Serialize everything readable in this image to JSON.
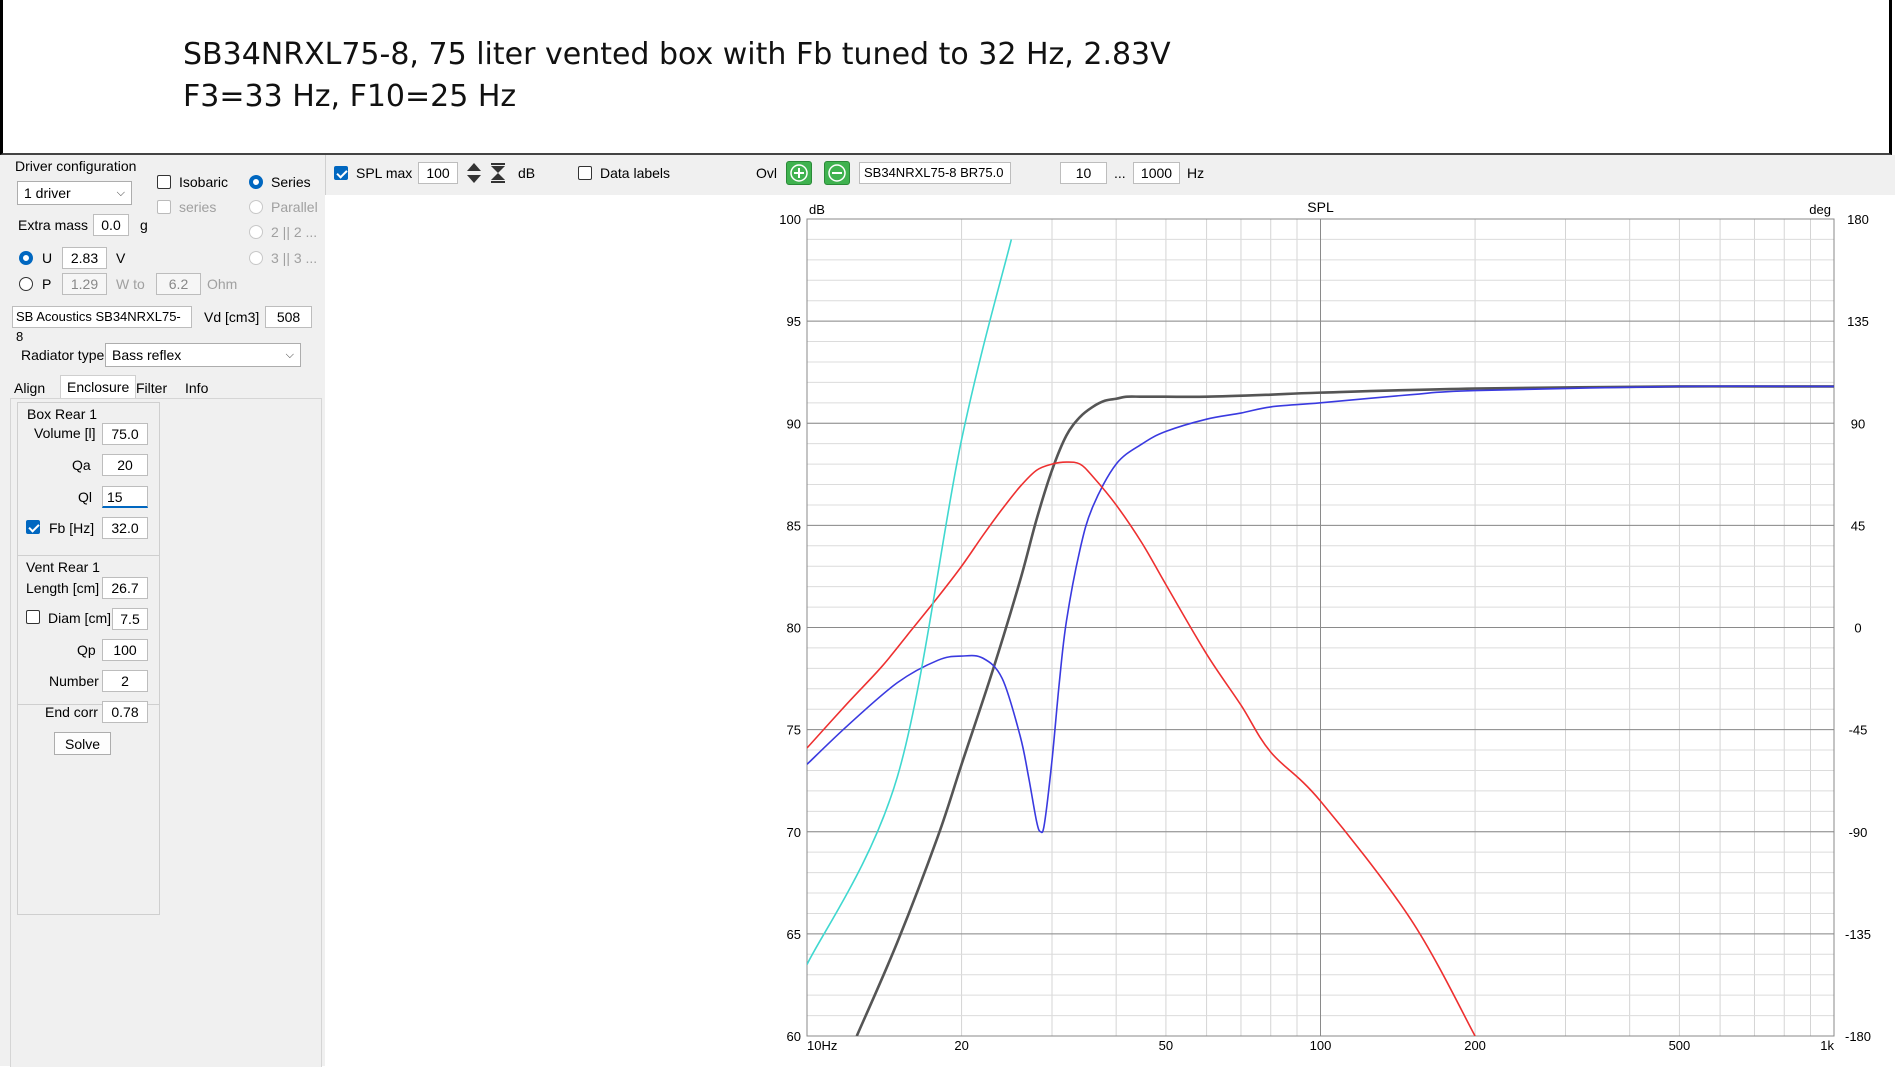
{
  "slide": {
    "title_line1": "SB34NRXL75-8, 75 liter vented box with Fb tuned to 32 Hz, 2.83V",
    "title_line2": "F3=33 Hz, F10=25 Hz"
  },
  "driver_config": {
    "group_label": "Driver configuration",
    "count_select": "1 driver",
    "isobaric_label": "Isobaric",
    "series_sub_label": "series",
    "series_label": "Series",
    "parallel_label": "Parallel",
    "opt_2x2": "2 || 2 ...",
    "opt_3x3": "3 || 3 ...",
    "extra_mass_label": "Extra mass",
    "extra_mass_value": "0.0",
    "extra_mass_unit": "g",
    "u_label": "U",
    "u_value": "2.83",
    "u_unit": "V",
    "p_label": "P",
    "p_value": "1.29",
    "w_to_label": "W to",
    "ohm_value": "6.2",
    "ohm_unit": "Ohm",
    "driver_name": "SB Acoustics SB34NRXL75-8",
    "vd_label": "Vd [cm3]",
    "vd_value": "508"
  },
  "radiator": {
    "label": "Radiator type",
    "value": "Bass reflex"
  },
  "tabs": [
    "Align",
    "Enclosure",
    "Filter",
    "Info"
  ],
  "box": {
    "group_label": "Box Rear 1",
    "volume_label": "Volume [l]",
    "volume_value": "75.0",
    "qa_label": "Qa",
    "qa_value": "20",
    "ql_label": "Ql",
    "ql_value": "15",
    "fb_label": "Fb [Hz]",
    "fb_value": "32.0"
  },
  "vent": {
    "group_label": "Vent Rear 1",
    "length_label": "Length [cm]",
    "length_value": "26.7",
    "diam_label": "Diam [cm]",
    "diam_value": "7.5",
    "qp_label": "Qp",
    "qp_value": "100",
    "number_label": "Number",
    "number_value": "2",
    "endcorr_label": "End corr",
    "endcorr_value": "0.78",
    "solve_label": "Solve"
  },
  "toolbar": {
    "spl_max_label": "SPL max",
    "spl_max_value": "100",
    "db_unit": "dB",
    "data_labels_label": "Data labels",
    "ovl_label": "Ovl",
    "overlay_name": "SB34NRXL75-8 BR75.0",
    "f_min": "10",
    "ellipsis": "...",
    "f_max": "1000",
    "hz_unit": "Hz"
  },
  "colors": {
    "accent": "#0067c0",
    "spl_black": "#555555",
    "phase_blue": "#3a3ae0",
    "red": "#ee3030",
    "cyan": "#40d8d0"
  },
  "chart_data": {
    "type": "line",
    "title": "SPL",
    "ylabel": "dB",
    "y2label": "deg",
    "x_scale": "log",
    "xlim": [
      10,
      1000
    ],
    "ylim": [
      60,
      100
    ],
    "y2lim": [
      -180,
      180
    ],
    "x_ticks": [
      {
        "v": 10,
        "label": "10Hz"
      },
      {
        "v": 20,
        "label": "20"
      },
      {
        "v": 50,
        "label": "50"
      },
      {
        "v": 100,
        "label": "100"
      },
      {
        "v": 200,
        "label": "200"
      },
      {
        "v": 500,
        "label": "500"
      },
      {
        "v": 1000,
        "label": "1k"
      }
    ],
    "y_ticks": [
      100,
      95,
      90,
      85,
      80,
      75,
      70,
      65,
      60
    ],
    "y2_ticks": [
      180,
      135,
      90,
      45,
      0,
      -45,
      -90,
      -135,
      -180
    ],
    "grid": true,
    "series": [
      {
        "color": "#555555",
        "x": [
          12.5,
          15,
          18,
          20,
          23,
          26,
          28,
          30,
          32,
          34,
          36,
          38,
          40,
          42,
          45,
          50,
          60,
          80,
          100,
          200,
          500,
          1000
        ],
        "y": [
          60,
          64.6,
          69.8,
          73.3,
          77.9,
          82.3,
          85.3,
          87.7,
          89.4,
          90.3,
          90.8,
          91.1,
          91.2,
          91.3,
          91.3,
          91.3,
          91.3,
          91.4,
          91.5,
          91.7,
          91.8,
          91.8
        ]
      },
      {
        "color": "#3a3ae0",
        "x": [
          10,
          12,
          15,
          18,
          20,
          22,
          24,
          26,
          27,
          28,
          28.5,
          29,
          30,
          31,
          32,
          34,
          36,
          40,
          45,
          50,
          60,
          70,
          80,
          100,
          150,
          200,
          500,
          1000
        ],
        "y": [
          73.3,
          75.2,
          77.3,
          78.4,
          78.6,
          78.5,
          77.5,
          74.7,
          72.7,
          70.5,
          70.0,
          70.4,
          73.5,
          77.3,
          80.3,
          83.8,
          85.9,
          88.0,
          89.0,
          89.6,
          90.2,
          90.5,
          90.8,
          91.0,
          91.4,
          91.6,
          91.8,
          91.8
        ]
      },
      {
        "color": "#ee3030",
        "x": [
          10,
          12,
          14,
          16,
          18,
          20,
          22,
          24,
          26,
          28,
          30,
          32,
          34,
          36,
          40,
          45,
          50,
          60,
          70,
          80,
          100,
          150,
          200
        ],
        "y": [
          74.1,
          76.3,
          78.1,
          79.9,
          81.5,
          83.0,
          84.5,
          85.8,
          86.9,
          87.7,
          88.0,
          88.1,
          88.0,
          87.4,
          86.0,
          84.1,
          82.1,
          78.7,
          76.2,
          73.9,
          71.5,
          65.7,
          60
        ]
      },
      {
        "color": "#40d8d0",
        "x": [
          10,
          15,
          20,
          25
        ],
        "y": [
          63.5,
          72.7,
          89.2,
          99
        ]
      }
    ]
  }
}
